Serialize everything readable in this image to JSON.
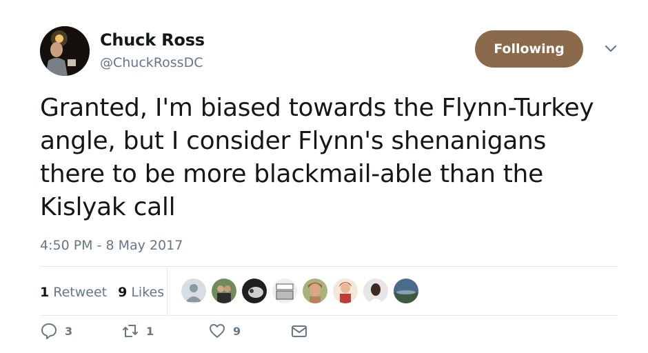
{
  "author": {
    "name": "Chuck Ross",
    "handle": "@ChuckRossDC"
  },
  "follow_button": {
    "label": "Following"
  },
  "tweet": {
    "lines": [
      "Granted, I'm biased towards the Flynn-Turkey",
      "angle, but I consider Flynn's shenanigans",
      "there to be more blackmail-able than the",
      "Kislyak call"
    ],
    "timestamp": "4:50 PM - 8 May 2017"
  },
  "stats": {
    "retweets_count": "1",
    "retweets_label": "Retweet",
    "likes_count": "9",
    "likes_label": "Likes"
  },
  "actions": {
    "reply_count": "3",
    "retweet_count": "1",
    "like_count": "9"
  },
  "colors": {
    "follow_button_bg": "#8b6a4b",
    "secondary_text": "#657786",
    "divider": "#e1e8ed"
  },
  "icons": [
    "caret-down-icon",
    "reply-icon",
    "retweet-icon",
    "heart-icon",
    "envelope-icon"
  ]
}
